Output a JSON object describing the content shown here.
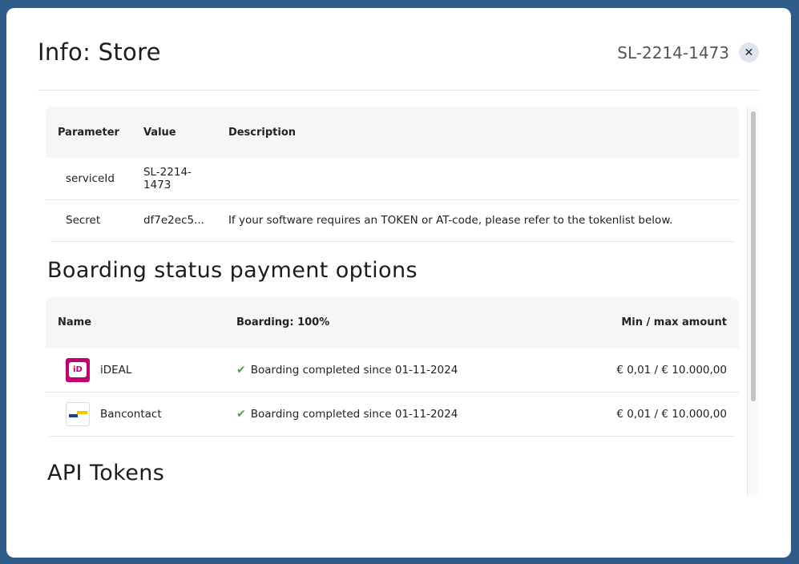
{
  "modal": {
    "title": "Info: Store",
    "service_id_header": "SL-2214-1473",
    "close_symbol": "✕"
  },
  "params_table": {
    "headers": [
      "Parameter",
      "Value",
      "Description"
    ],
    "rows": [
      {
        "parameter": "serviceId",
        "value": "SL-2214-1473",
        "description": ""
      },
      {
        "parameter": "Secret",
        "value": "df7e2ec5...",
        "description": "If your software requires an TOKEN or AT-code, please refer to the tokenlist below."
      }
    ]
  },
  "boarding": {
    "title": "Boarding status payment options",
    "headers": {
      "name": "Name",
      "boarding": "Boarding: 100%",
      "amount": "Min / max amount"
    },
    "rows": [
      {
        "name": "iDEAL",
        "logo": "ideal-logo",
        "status": "Boarding completed since 01-11-2024",
        "amount": "€ 0,01 / € 10.000,00"
      },
      {
        "name": "Bancontact",
        "logo": "bancontact-logo",
        "status": "Boarding completed since 01-11-2024",
        "amount": "€ 0,01 / € 10.000,00"
      }
    ]
  },
  "api_tokens": {
    "title": "API Tokens"
  },
  "colors": {
    "backdrop": "#2f5c8a",
    "ideal_brand": "#c4006f",
    "check_green": "#4aa44a"
  }
}
